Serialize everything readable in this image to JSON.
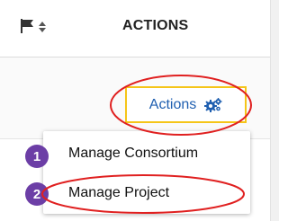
{
  "table_header": {
    "flag_icon": "flag-icon",
    "sort_icon": "sort-icon",
    "actions_label": "ACTIONS"
  },
  "actions_button": {
    "label": "Actions",
    "icon": "gears-icon",
    "accent_color": "#f5c518",
    "text_color": "#1f5fb0"
  },
  "dropdown_menu": {
    "items": [
      {
        "label": "Manage Consortium"
      },
      {
        "label": "Manage Project"
      }
    ]
  },
  "step_badges": [
    {
      "number": "1"
    },
    {
      "number": "2"
    }
  ],
  "colors": {
    "badge": "#6c3ea6",
    "annotation": "#e02020"
  }
}
